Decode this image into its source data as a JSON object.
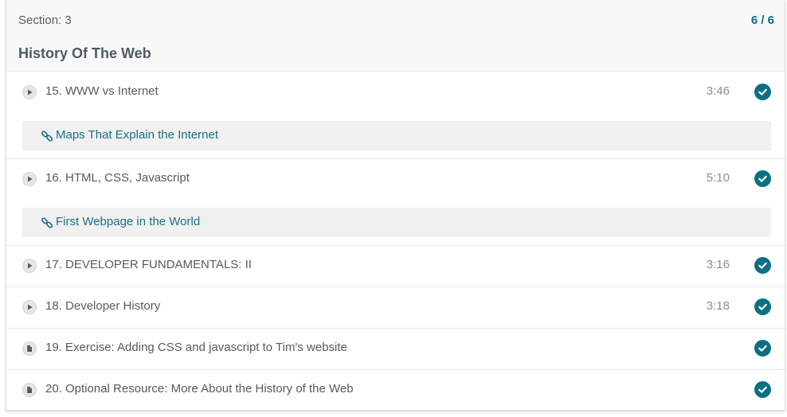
{
  "section": {
    "label": "Section: 3",
    "progress": "6 / 6",
    "title": "History Of The Web"
  },
  "lessons": [
    {
      "title": "15. WWW vs Internet",
      "duration": "3:46",
      "type": "video",
      "icon": "play-icon",
      "completed": true,
      "resource": "Maps That Explain the Internet"
    },
    {
      "title": "16. HTML, CSS, Javascript",
      "duration": "5:10",
      "type": "video",
      "icon": "play-icon",
      "completed": true,
      "resource": "First Webpage in the World"
    },
    {
      "title": "17. DEVELOPER FUNDAMENTALS: II",
      "duration": "3:16",
      "type": "video",
      "icon": "play-icon",
      "completed": true
    },
    {
      "title": "18. Developer History",
      "duration": "3:18",
      "type": "video",
      "icon": "play-icon",
      "completed": true
    },
    {
      "title": "19. Exercise: Adding CSS and javascript to Tim's website",
      "type": "article",
      "icon": "document-icon",
      "completed": true
    },
    {
      "title": "20. Optional Resource: More About the History of the Web",
      "type": "article",
      "icon": "document-icon",
      "completed": true
    }
  ],
  "colors": {
    "accent": "#0b6f85",
    "link": "#1a6f86",
    "header_bg": "#f8f8f8",
    "resource_bg": "#f0f0f0"
  }
}
